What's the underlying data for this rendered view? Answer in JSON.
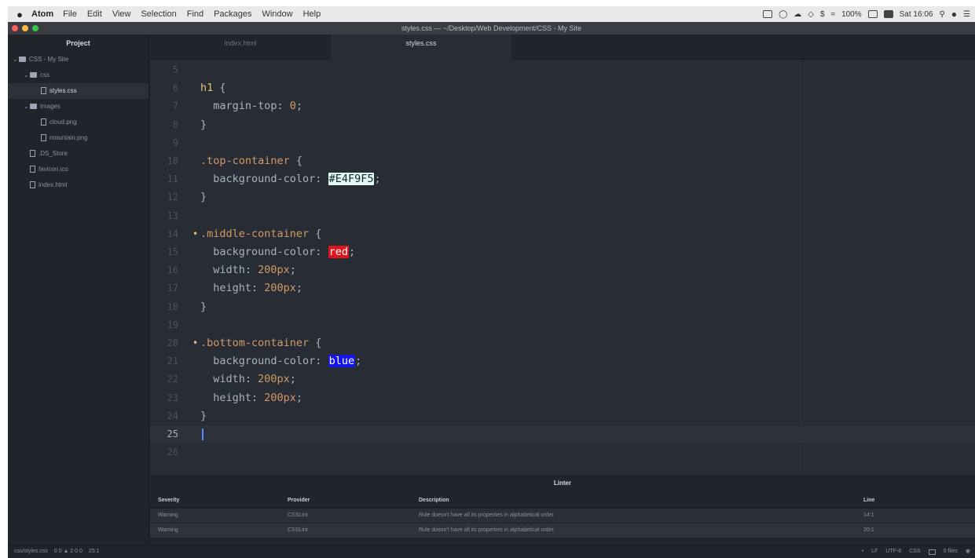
{
  "menubar": {
    "apple": "",
    "app_name": "Atom",
    "menus": [
      "File",
      "Edit",
      "View",
      "Selection",
      "Find",
      "Packages",
      "Window",
      "Help"
    ],
    "battery": "100%",
    "clock": "Sat 16:06"
  },
  "window": {
    "title": "styles.css — ~/Desktop/Web Development/CSS - My Site"
  },
  "sidebar": {
    "header": "Project",
    "items": [
      {
        "label": "CSS - My Site",
        "kind": "folder",
        "depth": 0
      },
      {
        "label": "css",
        "kind": "folder",
        "depth": 1
      },
      {
        "label": "styles.css",
        "kind": "file",
        "depth": 2,
        "selected": true
      },
      {
        "label": "images",
        "kind": "folder",
        "depth": 1
      },
      {
        "label": "cloud.png",
        "kind": "file",
        "depth": 2
      },
      {
        "label": "mountain.png",
        "kind": "file",
        "depth": 2
      },
      {
        "label": ".DS_Store",
        "kind": "file",
        "depth": 1
      },
      {
        "label": "favicon.ico",
        "kind": "file",
        "depth": 1
      },
      {
        "label": "index.html",
        "kind": "file",
        "depth": 1
      }
    ]
  },
  "tabs": [
    {
      "label": "index.html",
      "active": false
    },
    {
      "label": "styles.css",
      "active": true
    }
  ],
  "editor": {
    "lines": [
      {
        "num": "5",
        "code": [
          {
            "t": "",
            "c": "t-punc"
          }
        ]
      },
      {
        "num": "6",
        "code": [
          {
            "t": "h1",
            "c": "t-sel"
          },
          {
            "t": " {",
            "c": "t-punc"
          }
        ]
      },
      {
        "num": "7",
        "code": [
          {
            "t": "  margin-top: ",
            "c": "t-prop"
          },
          {
            "t": "0",
            "c": "t-num"
          },
          {
            "t": ";",
            "c": "t-punc"
          }
        ]
      },
      {
        "num": "8",
        "code": [
          {
            "t": "}",
            "c": "t-punc"
          }
        ]
      },
      {
        "num": "9",
        "code": []
      },
      {
        "num": "10",
        "code": [
          {
            "t": ".top-container",
            "c": "t-class"
          },
          {
            "t": " {",
            "c": "t-punc"
          }
        ]
      },
      {
        "num": "11",
        "code": [
          {
            "t": "  background-color: ",
            "c": "t-prop"
          },
          {
            "t": "#E4F9F5",
            "c": "t-col",
            "bg": "#E4F9F5",
            "fg": "#0a2a24"
          },
          {
            "t": ";",
            "c": "t-punc"
          }
        ]
      },
      {
        "num": "12",
        "code": [
          {
            "t": "}",
            "c": "t-punc"
          }
        ]
      },
      {
        "num": "13",
        "code": []
      },
      {
        "num": "14",
        "mark": true,
        "code": [
          {
            "t": ".middle-container",
            "c": "t-class"
          },
          {
            "t": " {",
            "c": "t-punc"
          }
        ]
      },
      {
        "num": "15",
        "code": [
          {
            "t": "  background-color: ",
            "c": "t-prop"
          },
          {
            "t": "red",
            "c": "t-col",
            "bg": "#e0151c",
            "fg": "#ffffff"
          },
          {
            "t": ";",
            "c": "t-punc"
          }
        ]
      },
      {
        "num": "16",
        "code": [
          {
            "t": "  width: ",
            "c": "t-prop"
          },
          {
            "t": "200px",
            "c": "t-num"
          },
          {
            "t": ";",
            "c": "t-punc"
          }
        ]
      },
      {
        "num": "17",
        "code": [
          {
            "t": "  height: ",
            "c": "t-prop"
          },
          {
            "t": "200px",
            "c": "t-num"
          },
          {
            "t": ";",
            "c": "t-punc"
          }
        ]
      },
      {
        "num": "18",
        "code": [
          {
            "t": "}",
            "c": "t-punc"
          }
        ]
      },
      {
        "num": "19",
        "code": []
      },
      {
        "num": "20",
        "mark": true,
        "code": [
          {
            "t": ".bottom-container",
            "c": "t-class"
          },
          {
            "t": " {",
            "c": "t-punc"
          }
        ]
      },
      {
        "num": "21",
        "code": [
          {
            "t": "  background-color: ",
            "c": "t-prop"
          },
          {
            "t": "blue",
            "c": "t-col",
            "bg": "#1414e6",
            "fg": "#ffffff"
          },
          {
            "t": ";",
            "c": "t-punc"
          }
        ]
      },
      {
        "num": "22",
        "code": [
          {
            "t": "  width: ",
            "c": "t-prop"
          },
          {
            "t": "200px",
            "c": "t-num"
          },
          {
            "t": ";",
            "c": "t-punc"
          }
        ]
      },
      {
        "num": "23",
        "code": [
          {
            "t": "  height: ",
            "c": "t-prop"
          },
          {
            "t": "200px",
            "c": "t-num"
          },
          {
            "t": ";",
            "c": "t-punc"
          }
        ]
      },
      {
        "num": "24",
        "code": [
          {
            "t": "}",
            "c": "t-punc"
          }
        ]
      },
      {
        "num": "25",
        "cursor": true,
        "code": []
      },
      {
        "num": "26",
        "code": []
      }
    ]
  },
  "linter": {
    "title": "Linter",
    "columns": [
      "Severity",
      "Provider",
      "Description",
      "Line"
    ],
    "rows": [
      {
        "severity": "Warning",
        "provider": "CSSLint",
        "description": "Rule doesn't have all its properties in alphabetical order.",
        "line": "14:1"
      },
      {
        "severity": "Warning",
        "provider": "CSSLint",
        "description": "Rule doesn't have all its properties in alphabetical order.",
        "line": "20:1"
      }
    ]
  },
  "statusbar": {
    "path": "css/styles.css",
    "counts": "0 0 ▲ 2 0 0",
    "cursor_pos": "25:1",
    "line_ending": "LF",
    "encoding": "UTF-8",
    "grammar": "CSS",
    "files": "0 files"
  },
  "colors": {
    "editor_bg": "#282c34",
    "selector": "#e5c07b",
    "class_selector": "#d19a66",
    "number": "#d19a66",
    "property": "#abb2bf"
  }
}
